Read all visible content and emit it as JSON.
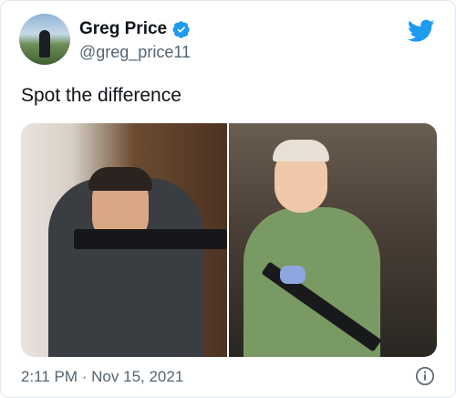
{
  "author": {
    "name": "Greg Price",
    "handle": "@greg_price11"
  },
  "tweet": {
    "text": "Spot the difference",
    "timestamp": "2:11 PM · Nov 15, 2021"
  },
  "icons": {
    "verified": "verified-badge-icon",
    "brand": "twitter-bird-icon",
    "info": "info-icon"
  },
  "colors": {
    "brand": "#1d9bf0",
    "text": "#0f1419",
    "muted": "#536471"
  }
}
